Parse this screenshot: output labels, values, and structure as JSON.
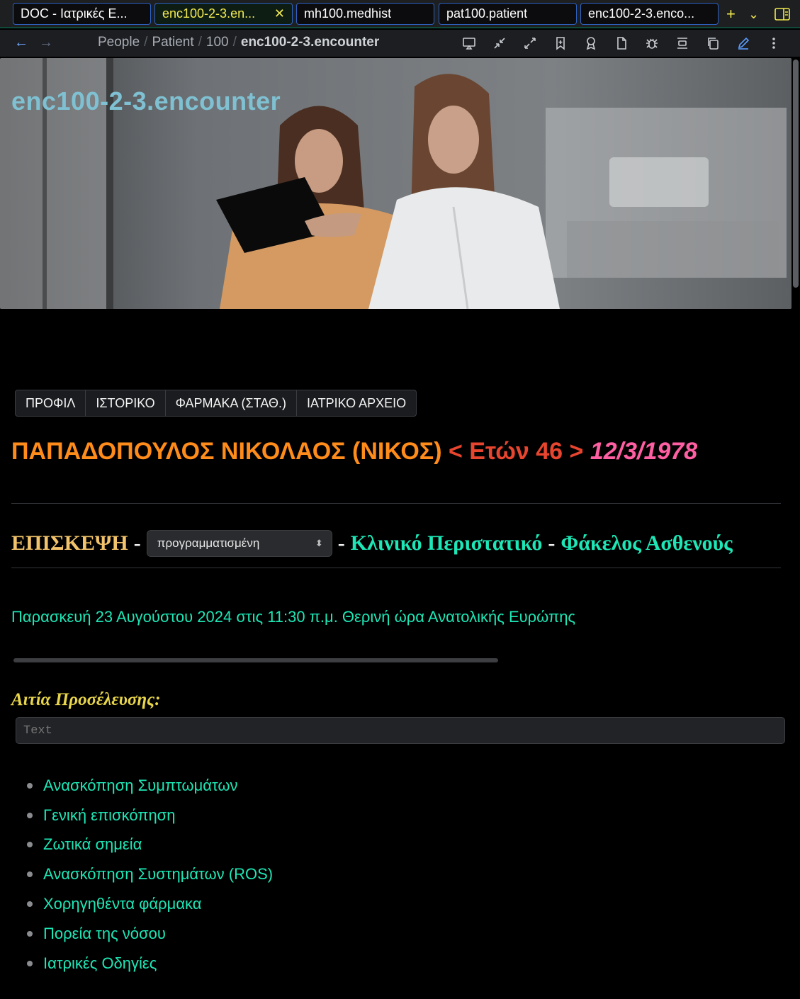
{
  "tabs": [
    {
      "label": "DOC - Ιατρικές Ε...",
      "active": false
    },
    {
      "label": "enc100-2-3.en...",
      "active": true
    },
    {
      "label": "mh100.medhist",
      "active": false
    },
    {
      "label": "pat100.patient",
      "active": false
    },
    {
      "label": "enc100-2-3.enco...",
      "active": false
    }
  ],
  "tab_actions": {
    "new_tab": "+",
    "more_tabs": "⌄",
    "sidebar_toggle": "sidebar-icon"
  },
  "breadcrumb": {
    "items": [
      "People",
      "Patient",
      "100"
    ],
    "current": "enc100-2-3.encounter"
  },
  "nav_icons": [
    "cast-icon",
    "collapse-icon",
    "expand-icon",
    "bookmark-icon",
    "badge-icon",
    "file-icon",
    "bug-icon",
    "align-icon",
    "copy-icon",
    "edit-icon",
    "more-icon"
  ],
  "banner": {
    "title": "enc100-2-3.encounter"
  },
  "section_tabs": [
    "ΠΡΟΦΙΛ",
    "ΙΣΤΟΡΙΚΟ",
    "ΦΑΡΜΑΚΑ (ΣΤΑΘ.)",
    "ΙΑΤΡΙΚΟ ΑΡΧΕΙΟ"
  ],
  "patient": {
    "name": "ΠΑΠΑΔΟΠΟΥΛΟΣ ΝΙΚΟΛΑΟΣ (ΝΙΚΟΣ)",
    "age": "< Ετών 46 >",
    "dob": "12/3/1978"
  },
  "visit": {
    "label": "ΕΠΙΣΚΕΨΗ",
    "separator": "-",
    "status": "προγραμματισμένη",
    "clinical_case": "Κλινικό Περιστατικό",
    "patient_folder": "Φάκελος Ασθενούς"
  },
  "timestamp": "Παρασκευή 23 Αυγούστου 2024 στις 11:30 π.μ. Θερινή ώρα Ανατολικής Ευρώπης",
  "progress": {
    "value": 0.0
  },
  "reason": {
    "label": "Αιτία Προσέλευσης:",
    "placeholder": "Text",
    "value": ""
  },
  "links": [
    "Ανασκόπηση Συμπτωμάτων",
    "Γενική επισκόπηση",
    "Ζωτικά σημεία",
    "Ανασκόπηση Συστημάτων (ROS)",
    "Χορηγηθέντα φάρμακα",
    "Πορεία της νόσου",
    "Ιατρικές Οδηγίες"
  ],
  "colors": {
    "name": "#ff8c1a",
    "age": "#e8452f",
    "dob": "#ff5fa2",
    "visit_label": "#f2c36b",
    "accent_teal": "#1de7b6",
    "reason_label": "#e8d54a"
  }
}
